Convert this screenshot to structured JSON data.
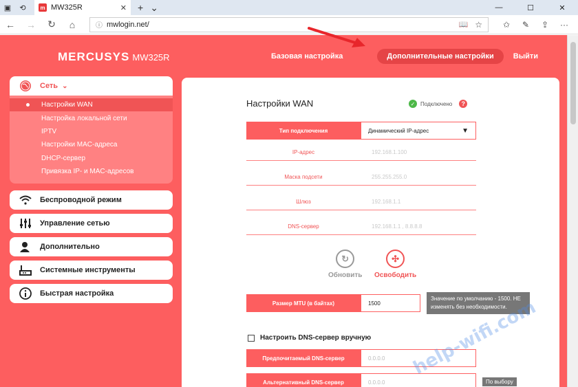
{
  "browser": {
    "tab_title": "MW325R",
    "url": "mwlogin.net/",
    "favicon_letter": "m"
  },
  "router": {
    "brand": "MERCUSYS",
    "model": "MW325R",
    "nav": {
      "basic": "Базовая настройка",
      "advanced": "Дополнительные настройки",
      "logout": "Выйти"
    },
    "sidebar": {
      "network": "Сеть",
      "sub_items": [
        "Настройки WAN",
        "Настройка локальной сети",
        "IPTV",
        "Настройки MAC-адреса",
        "DHCP-сервер",
        "Привязка IP- и MAC-адресов"
      ],
      "groups": [
        "Беспроводной режим",
        "Управление сетью",
        "Дополнительно",
        "Системные инструменты",
        "Быстрая настройка"
      ]
    },
    "wan": {
      "title": "Настройки WAN",
      "status": "Подключено",
      "conn_type_label": "Тип подключения",
      "conn_type_value": "Динамический IP-адрес",
      "ip_label": "IP-адрес",
      "ip_value": "192.168.1.100",
      "mask_label": "Маска подсети",
      "mask_value": "255.255.255.0",
      "gateway_label": "Шлюз",
      "gateway_value": "192.168.1.1",
      "dns_label": "DNS-сервер",
      "dns_value": "192.168.1.1 , 8.8.8.8",
      "renew": "Обновить",
      "release": "Освободить",
      "mtu_label": "Размер MTU (в байтах)",
      "mtu_value": "1500",
      "mtu_hint": "Значение по умолчанию - 1500. НЕ изменять без необходимости.",
      "manual_dns": "Настроить DNS-сервер вручную",
      "pref_dns_label": "Предпочитаемый DNS-сервер",
      "pref_dns_placeholder": "0.0.0.0",
      "alt_dns_label": "Альтернативный DNS-сервер",
      "alt_dns_placeholder": "0.0.0.0",
      "optional": "По выбору"
    },
    "watermark": "help-wifi.com"
  },
  "colors": {
    "accent": "#fd5e5f",
    "ok": "#4db848"
  }
}
